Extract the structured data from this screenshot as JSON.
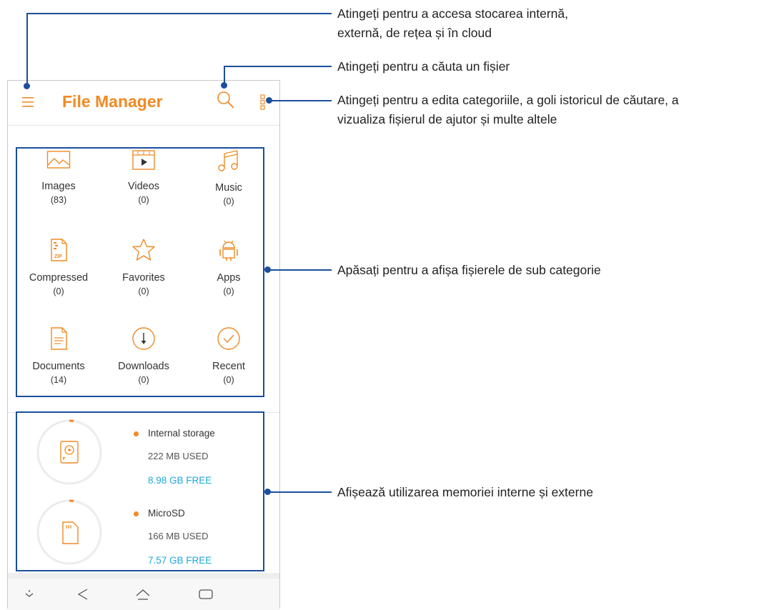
{
  "app": {
    "title": "File Manager",
    "brand_color": "#f08a24",
    "free_color": "#1fa8dc",
    "annotation_color": "#1b4f9b"
  },
  "toolbar": {
    "menu_icon": "hamburger-icon",
    "search_icon": "search-icon",
    "more_icon": "more-options-icon"
  },
  "categories": [
    {
      "label": "Images",
      "count": "(83)",
      "icon": "image-icon"
    },
    {
      "label": "Videos",
      "count": "(0)",
      "icon": "video-icon"
    },
    {
      "label": "Music",
      "count": "(0)",
      "icon": "music-note-icon"
    },
    {
      "label": "Compressed",
      "count": "(0)",
      "icon": "zip-file-icon"
    },
    {
      "label": "Favorites",
      "count": "(0)",
      "icon": "star-icon"
    },
    {
      "label": "Apps",
      "count": "(0)",
      "icon": "android-icon"
    },
    {
      "label": "Documents",
      "count": "(14)",
      "icon": "document-icon"
    },
    {
      "label": "Downloads",
      "count": "(0)",
      "icon": "download-icon"
    },
    {
      "label": "Recent",
      "count": "(0)",
      "icon": "check-circle-icon"
    }
  ],
  "storage": [
    {
      "name": "Internal storage",
      "used": "222 MB USED",
      "free": "8.98 GB FREE",
      "icon": "hard-disk-icon"
    },
    {
      "name": "MicroSD",
      "used": "166 MB USED",
      "free": "7.57 GB FREE",
      "icon": "sd-card-icon"
    }
  ],
  "navbar": {
    "icons": [
      "notification-down-icon",
      "back-icon",
      "home-icon",
      "recents-icon"
    ]
  },
  "callouts": {
    "menu": [
      "Atingeți pentru a accesa stocarea internă,",
      "externă, de rețea și în cloud"
    ],
    "search": [
      "Atingeți pentru a căuta un fișier"
    ],
    "more": [
      "Atingeți pentru a edita categoriile, a goli istoricul de căutare, a",
      "vizualiza fișierul de ajutor și multe altele"
    ],
    "categories": [
      "Apăsați pentru a afișa fișierele de sub categorie"
    ],
    "storage": [
      "Afișează utilizarea memoriei interne și externe"
    ]
  }
}
